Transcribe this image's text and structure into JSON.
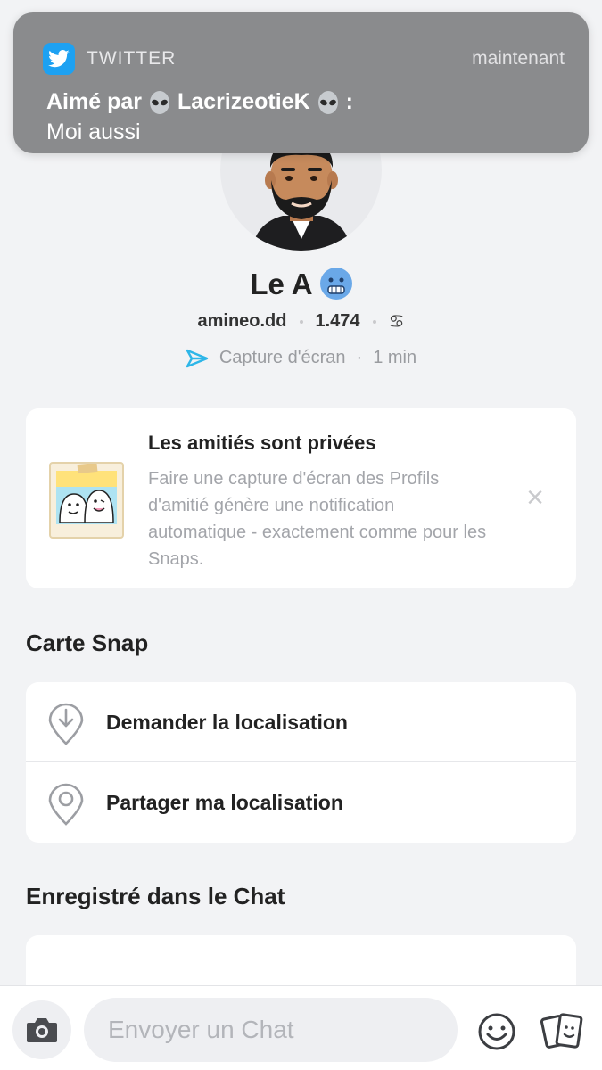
{
  "notification": {
    "app": "TWITTER",
    "time": "maintenant",
    "title_prefix": "Aimé par",
    "title_user": "LacrizeotieK",
    "title_suffix": ":",
    "body": "Moi aussi",
    "icon": "twitter-bird-icon"
  },
  "profile": {
    "name": "Le A",
    "name_emoji": "cold-face-emoji",
    "username": "amineo.dd",
    "score": "1.474",
    "zodiac_symbol": "♋",
    "activity": "Capture d'écran",
    "activity_sep": "·",
    "activity_time": "1 min"
  },
  "privacy_card": {
    "title": "Les amitiés sont privées",
    "text": "Faire une capture d'écran des Profils d'amitié génère une notification automatique - exactement comme pour les Snaps.",
    "close": "×"
  },
  "snap_map": {
    "section_title": "Carte Snap",
    "items": [
      {
        "label": "Demander la localisation",
        "icon": "location-request-icon"
      },
      {
        "label": "Partager ma localisation",
        "icon": "location-pin-icon"
      }
    ]
  },
  "saved_chat": {
    "section_title": "Enregistré dans le Chat"
  },
  "chat_bar": {
    "placeholder": "Envoyer un Chat"
  },
  "colors": {
    "twitter_blue": "#1da1f2",
    "screenshot_icon": "#2eb6e8",
    "background": "#f2f3f5"
  }
}
